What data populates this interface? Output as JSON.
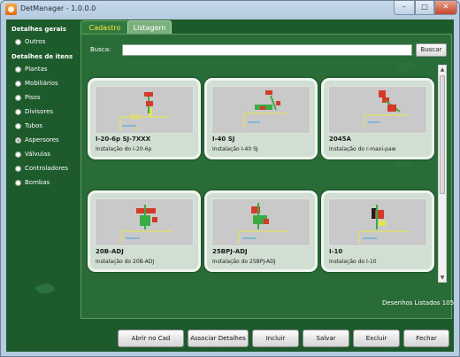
{
  "window": {
    "title": "DetManager - 1.0.0.0",
    "min": "–",
    "max": "□",
    "close": "✕"
  },
  "sidebar": {
    "groups": [
      {
        "title": "Detalhes gerais",
        "items": [
          {
            "label": "Outros",
            "checked": false
          }
        ]
      },
      {
        "title": "Detalhes de itens",
        "items": [
          {
            "label": "Plantas",
            "checked": false
          },
          {
            "label": "Mobiliários",
            "checked": false
          },
          {
            "label": "Pisos",
            "checked": false
          },
          {
            "label": "Divisores",
            "checked": false
          },
          {
            "label": "Tubos",
            "checked": false
          },
          {
            "label": "Aspersores",
            "checked": true
          },
          {
            "label": "Válvulas",
            "checked": false
          },
          {
            "label": "Controladores",
            "checked": false
          },
          {
            "label": "Bombas",
            "checked": false
          }
        ]
      }
    ]
  },
  "tabs": [
    {
      "label": "Cadastro",
      "active": true
    },
    {
      "label": "Listagem",
      "active": false
    }
  ],
  "search": {
    "label": "Busca:",
    "value": "",
    "button": "Buscar"
  },
  "cards": [
    {
      "title": "I-20-6p SJ-7XXX",
      "desc": "Instalação do I-20-6p"
    },
    {
      "title": "I-40 SJ",
      "desc": "Instalação I-40 SJ"
    },
    {
      "title": "2045A",
      "desc": "Instalação do r-maxi-paw"
    },
    {
      "title": "20B-ADJ",
      "desc": "Instalação do 20B-ADJ"
    },
    {
      "title": "25BPJ-ADJ",
      "desc": "Instalação do 25BPJ-ADJ"
    },
    {
      "title": "I-10",
      "desc": "Instalação do I-10"
    }
  ],
  "listing": {
    "count_text": "Desenhos Listados 105"
  },
  "actions": {
    "open_cad": "Abrir no Cad",
    "associate": "Associar Detalhes",
    "add": "Incluir",
    "save": "Salvar",
    "delete": "Excluir",
    "close": "Fechar"
  },
  "icons": {
    "app": "app-icon",
    "scroll_up": "▲",
    "scroll_down": "▼"
  },
  "colors": {
    "background": "#1d5a2c",
    "panel": "#2a6c38",
    "active_tab_text": "#ffe24a",
    "card": "#d1dfd3"
  }
}
